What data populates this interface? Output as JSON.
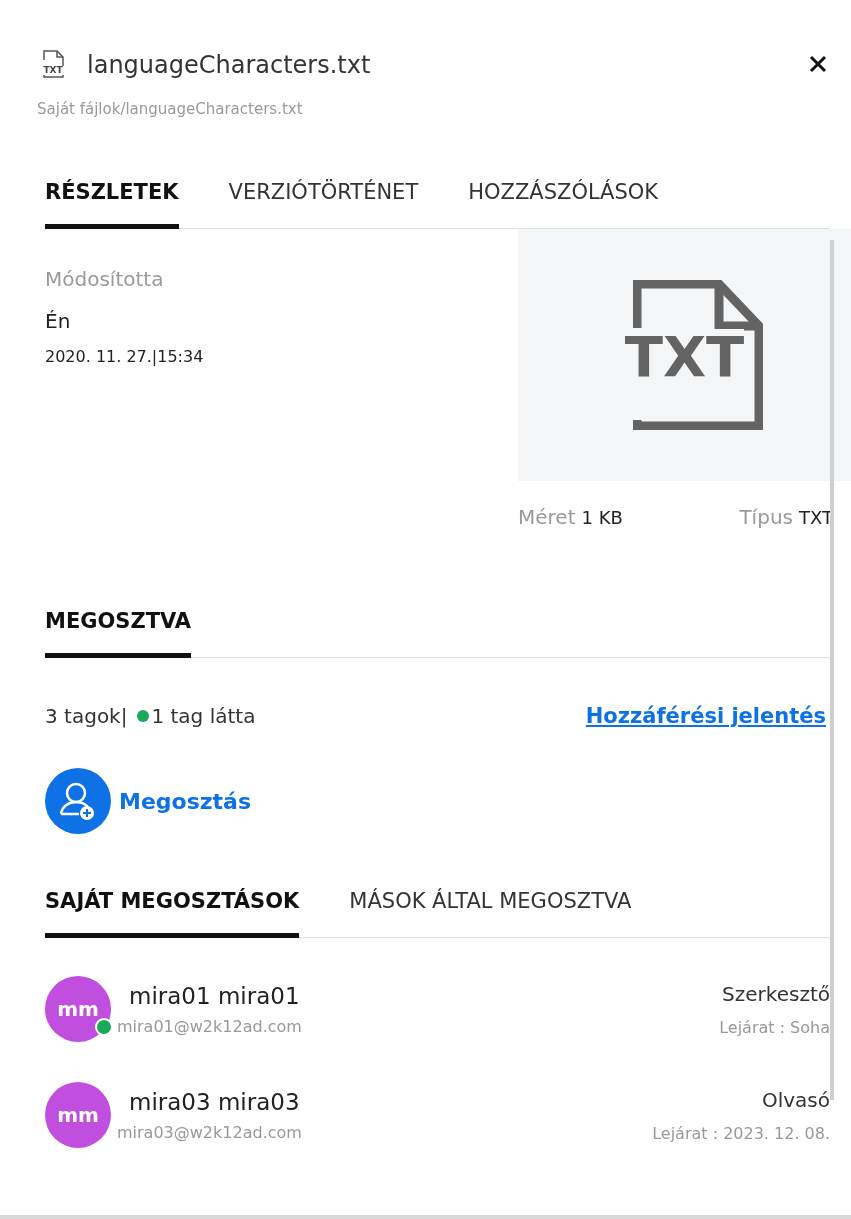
{
  "header": {
    "file_name": "languageCharacters.txt",
    "path": "Saját fájlok/languageCharacters.txt",
    "file_icon_label": "TXT"
  },
  "tabs": [
    {
      "label": "RÉSZLETEK",
      "selected": true
    },
    {
      "label": "VERZIÓTÖRTÉNET",
      "selected": false
    },
    {
      "label": "HOZZÁSZÓLÁSOK",
      "selected": false
    }
  ],
  "details": {
    "modified_by_label": "Módosította",
    "modified_by": "Én",
    "modified_at": "2020. 11. 27.|15:34",
    "preview_label": "TXT",
    "size_label": "Méret",
    "size": "1 KB",
    "type_label": "Típus",
    "type": "TXT"
  },
  "shared": {
    "tab": {
      "label": "MEGOSZTVA",
      "selected": true
    },
    "members": "3 tagok|",
    "seen": "1 tag látta",
    "report_link": "Hozzáférési jelentés",
    "share_button": "Megosztás"
  },
  "share_tabs": [
    {
      "label": "SAJÁT MEGOSZTÁSOK",
      "selected": true
    },
    {
      "label": "MÁSOK ÁLTAL MEGOSZTVA",
      "selected": false
    }
  ],
  "shares": [
    {
      "initials": "mm",
      "name": "mira01 mira01",
      "email": "mira01@w2k12ad.com",
      "role": "Szerkesztő",
      "expiry": "Lejárat : Soha",
      "online": true,
      "color": "#c04fdf"
    },
    {
      "initials": "mm",
      "name": "mira03 mira03",
      "email": "mira03@w2k12ad.com",
      "role": "Olvasó",
      "expiry": "Lejárat : 2023. 12. 08.",
      "online": false,
      "color": "#c04fdf"
    }
  ]
}
